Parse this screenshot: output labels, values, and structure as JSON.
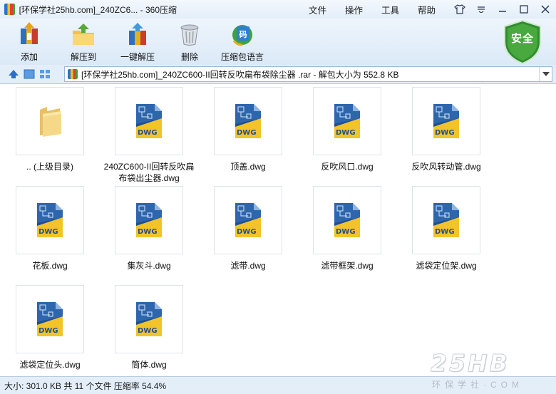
{
  "window": {
    "title": "[环保学社25hb.com]_240ZC6... - 360压缩",
    "menu": [
      "文件",
      "操作",
      "工具",
      "帮助"
    ]
  },
  "toolbar": {
    "buttons": [
      {
        "label": "添加",
        "icon": "add-archive-icon"
      },
      {
        "label": "解压到",
        "icon": "extract-to-icon"
      },
      {
        "label": "一键解压",
        "icon": "one-click-extract-icon"
      },
      {
        "label": "删除",
        "icon": "delete-icon"
      },
      {
        "label": "压缩包语言",
        "icon": "archive-language-icon"
      }
    ],
    "security_badge": "安全"
  },
  "address": {
    "path": "[环保学社25hb.com]_240ZC600-II回转反吹扁布袋除尘器 .rar - 解包大小为 552.8 KB"
  },
  "files": [
    {
      "name": ".. (上级目录)",
      "type": "folder"
    },
    {
      "name": "240ZC600-II回转反吹扁布袋出尘器.dwg",
      "type": "dwg"
    },
    {
      "name": "顶盖.dwg",
      "type": "dwg"
    },
    {
      "name": "反吹风口.dwg",
      "type": "dwg"
    },
    {
      "name": "反吹风转动管.dwg",
      "type": "dwg"
    },
    {
      "name": "花板.dwg",
      "type": "dwg"
    },
    {
      "name": "集灰斗.dwg",
      "type": "dwg"
    },
    {
      "name": "滤带.dwg",
      "type": "dwg"
    },
    {
      "name": "滤带框架.dwg",
      "type": "dwg"
    },
    {
      "name": "滤袋定位架.dwg",
      "type": "dwg"
    },
    {
      "name": "滤袋定位头.dwg",
      "type": "dwg"
    },
    {
      "name": "筒体.dwg",
      "type": "dwg"
    }
  ],
  "dwg_badge": "DWG",
  "status": {
    "text": "大小: 301.0 KB 共 11 个文件 压缩率 54.4%"
  },
  "watermark": {
    "logo": "25HB",
    "caption": "环保学社·COM"
  },
  "colors": {
    "accent": "#2b6fc4",
    "shield": "#3f9b3a",
    "dwg_yellow": "#f2c42a",
    "dwg_blue": "#1f4f8f"
  }
}
